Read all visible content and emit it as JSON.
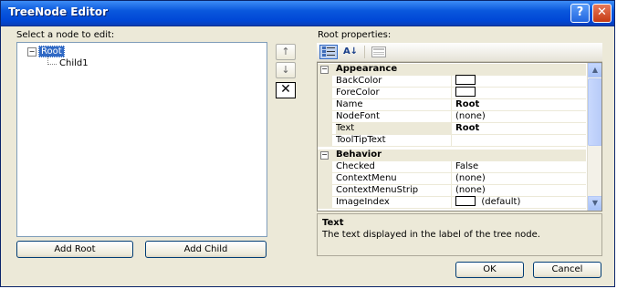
{
  "window": {
    "title": "TreeNode Editor",
    "help_glyph": "?",
    "close_glyph": "✕"
  },
  "left": {
    "label": "Select a node to edit:",
    "tree": {
      "root": {
        "label": "Root",
        "expander": "−"
      },
      "child": {
        "label": "Child1"
      }
    },
    "add_root_label": "Add Root",
    "add_child_label": "Add Child"
  },
  "move_buttons": {
    "up_glyph": "↑",
    "down_glyph": "↓",
    "delete_glyph": "✕"
  },
  "right": {
    "label": "Root properties:",
    "toolbar": {
      "categorized_icon": "categorized-icon",
      "alphabetical_glyph": "A↓",
      "property_pages_icon": "property-pages-icon"
    },
    "categories": [
      {
        "name": "Appearance",
        "toggle": "−",
        "props": [
          {
            "name": "BackColor",
            "value": "",
            "swatch": true
          },
          {
            "name": "ForeColor",
            "value": "",
            "swatch": true
          },
          {
            "name": "Name",
            "value": "Root",
            "bold": true
          },
          {
            "name": "NodeFont",
            "value": "(none)"
          },
          {
            "name": "Text",
            "value": "Root",
            "bold": true,
            "selected": true
          },
          {
            "name": "ToolTipText",
            "value": ""
          }
        ]
      },
      {
        "name": "Behavior",
        "toggle": "−",
        "props": [
          {
            "name": "Checked",
            "value": "False"
          },
          {
            "name": "ContextMenu",
            "value": "(none)"
          },
          {
            "name": "ContextMenuStrip",
            "value": "(none)"
          },
          {
            "name": "ImageIndex",
            "value": "(default)",
            "swatch": true
          }
        ]
      }
    ],
    "description": {
      "title": "Text",
      "text": "The text displayed in the label of the tree node."
    }
  },
  "footer": {
    "ok_label": "OK",
    "cancel_label": "Cancel"
  },
  "colors": {
    "titlebar": "#0a58dd",
    "selection": "#316ac5",
    "face": "#ece9d8"
  }
}
